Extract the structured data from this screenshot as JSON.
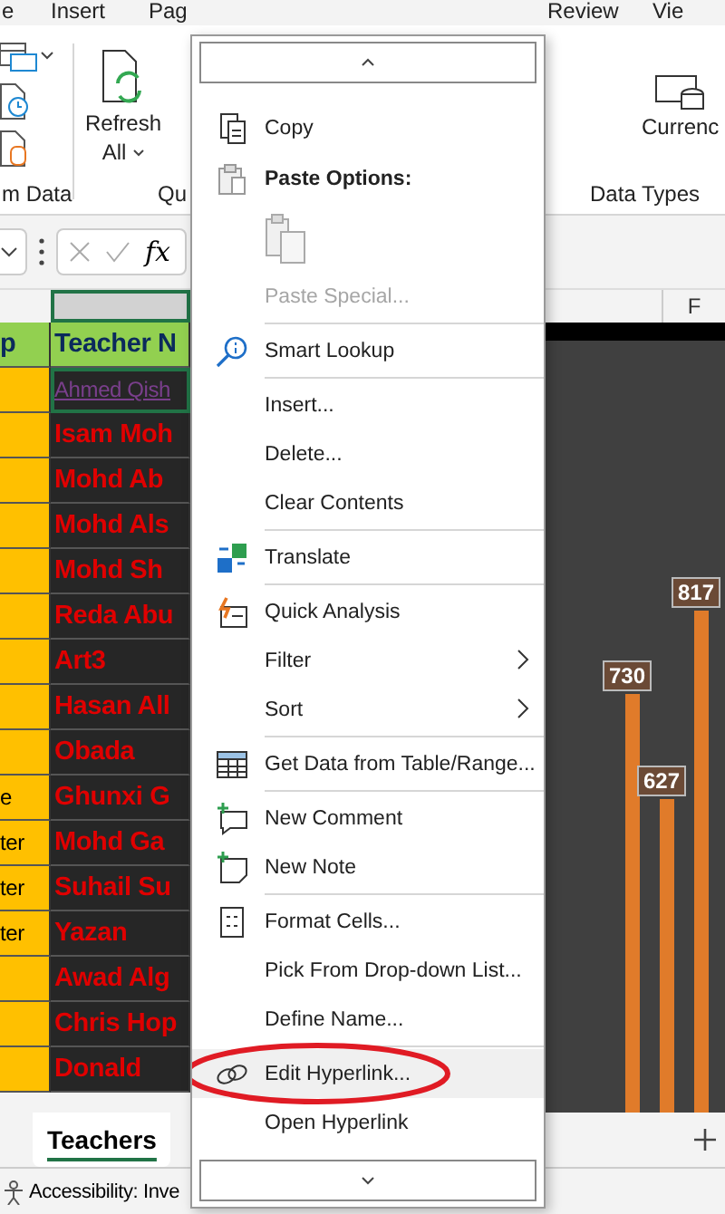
{
  "ribbon": {
    "tabs": [
      "e",
      "Insert",
      "Pag",
      "Review",
      "Vie"
    ],
    "groups": [
      {
        "label": "m Data"
      },
      {
        "label": "Qu"
      },
      {
        "label": "Data Types"
      }
    ],
    "buttons": [
      {
        "label": "Refresh",
        "sublabel": "All"
      },
      {
        "label": "Currenc"
      }
    ]
  },
  "formula_bar": {
    "function_label": "fx"
  },
  "sheet": {
    "column_headers": [
      "F"
    ],
    "header_row": {
      "column_1": "p",
      "column_2": "Teacher N"
    },
    "rows": [
      {
        "name": "Ahmed Qish",
        "hyperlink": true,
        "selected": true
      },
      {
        "name": "Isam Moh",
        "hyperlink": false,
        "selected": false
      },
      {
        "name": "Mohd Ab",
        "hyperlink": false,
        "selected": false
      },
      {
        "name": "Mohd Als",
        "hyperlink": false,
        "selected": false
      },
      {
        "name": "Mohd Sh",
        "hyperlink": false,
        "selected": false
      },
      {
        "name": "Reda Abu",
        "hyperlink": false,
        "selected": false
      },
      {
        "name": "Art3",
        "hyperlink": false,
        "selected": false
      },
      {
        "name": "Hasan All",
        "hyperlink": false,
        "selected": false
      },
      {
        "name": "Obada",
        "hyperlink": false,
        "selected": false
      },
      {
        "column_1": "e",
        "name": "Ghunxi G",
        "hyperlink": false,
        "selected": false
      },
      {
        "column_1": "ter",
        "name": "Mohd Ga",
        "hyperlink": false,
        "selected": false
      },
      {
        "column_1": "ter",
        "name": "Suhail Su",
        "hyperlink": false,
        "selected": false
      },
      {
        "column_1": "ter",
        "name": "Yazan",
        "hyperlink": false,
        "selected": false
      },
      {
        "name": "Awad Alg",
        "hyperlink": false,
        "selected": false
      },
      {
        "name": "Chris Hop",
        "hyperlink": false,
        "selected": false
      },
      {
        "name": "Donald",
        "hyperlink": false,
        "selected": false
      }
    ],
    "chart": {
      "bar_labels": [
        "730",
        "627",
        "817"
      ]
    }
  },
  "sheet_tabs": [
    {
      "label": "Teachers",
      "selected": true
    }
  ],
  "status_bar": {
    "text": "Accessibility: Inve"
  },
  "context_menu": {
    "items": [
      {
        "kind": "item",
        "label": "Copy",
        "disabled": false,
        "selected": false,
        "submenu": false,
        "circled": false
      },
      {
        "kind": "heading",
        "label": "Paste Options:"
      },
      {
        "kind": "paste-icons"
      },
      {
        "kind": "item",
        "label": "Paste Special...",
        "disabled": true,
        "selected": false,
        "submenu": false,
        "circled": false
      },
      {
        "kind": "separator"
      },
      {
        "kind": "item",
        "label": "Smart Lookup",
        "disabled": false,
        "selected": false,
        "submenu": false,
        "circled": false
      },
      {
        "kind": "separator"
      },
      {
        "kind": "item",
        "label": "Insert...",
        "disabled": false,
        "selected": false,
        "submenu": false,
        "circled": false
      },
      {
        "kind": "item",
        "label": "Delete...",
        "disabled": false,
        "selected": false,
        "submenu": false,
        "circled": false
      },
      {
        "kind": "item",
        "label": "Clear Contents",
        "disabled": false,
        "selected": false,
        "submenu": false,
        "circled": false
      },
      {
        "kind": "separator"
      },
      {
        "kind": "item",
        "label": "Translate",
        "disabled": false,
        "selected": false,
        "submenu": false,
        "circled": false
      },
      {
        "kind": "separator"
      },
      {
        "kind": "item",
        "label": "Quick Analysis",
        "disabled": false,
        "selected": false,
        "submenu": false,
        "circled": false
      },
      {
        "kind": "item",
        "label": "Filter",
        "disabled": false,
        "selected": false,
        "submenu": true,
        "circled": false
      },
      {
        "kind": "item",
        "label": "Sort",
        "disabled": false,
        "selected": false,
        "submenu": true,
        "circled": false
      },
      {
        "kind": "separator"
      },
      {
        "kind": "item",
        "label": "Get Data from Table/Range...",
        "disabled": false,
        "selected": false,
        "submenu": false,
        "circled": false
      },
      {
        "kind": "separator"
      },
      {
        "kind": "item",
        "label": "New Comment",
        "disabled": false,
        "selected": false,
        "submenu": false,
        "circled": false
      },
      {
        "kind": "item",
        "label": "New Note",
        "disabled": false,
        "selected": false,
        "submenu": false,
        "circled": false
      },
      {
        "kind": "separator"
      },
      {
        "kind": "item",
        "label": "Format Cells...",
        "disabled": false,
        "selected": false,
        "submenu": false,
        "circled": false
      },
      {
        "kind": "item",
        "label": "Pick From Drop-down List...",
        "disabled": false,
        "selected": false,
        "submenu": false,
        "circled": false
      },
      {
        "kind": "item",
        "label": "Define Name...",
        "disabled": false,
        "selected": false,
        "submenu": false,
        "circled": false
      },
      {
        "kind": "separator"
      },
      {
        "kind": "item",
        "label": "Edit Hyperlink...",
        "disabled": false,
        "selected": true,
        "submenu": false,
        "circled": true
      },
      {
        "kind": "item",
        "label": "Open Hyperlink",
        "disabled": false,
        "selected": false,
        "submenu": false,
        "circled": false
      }
    ]
  }
}
